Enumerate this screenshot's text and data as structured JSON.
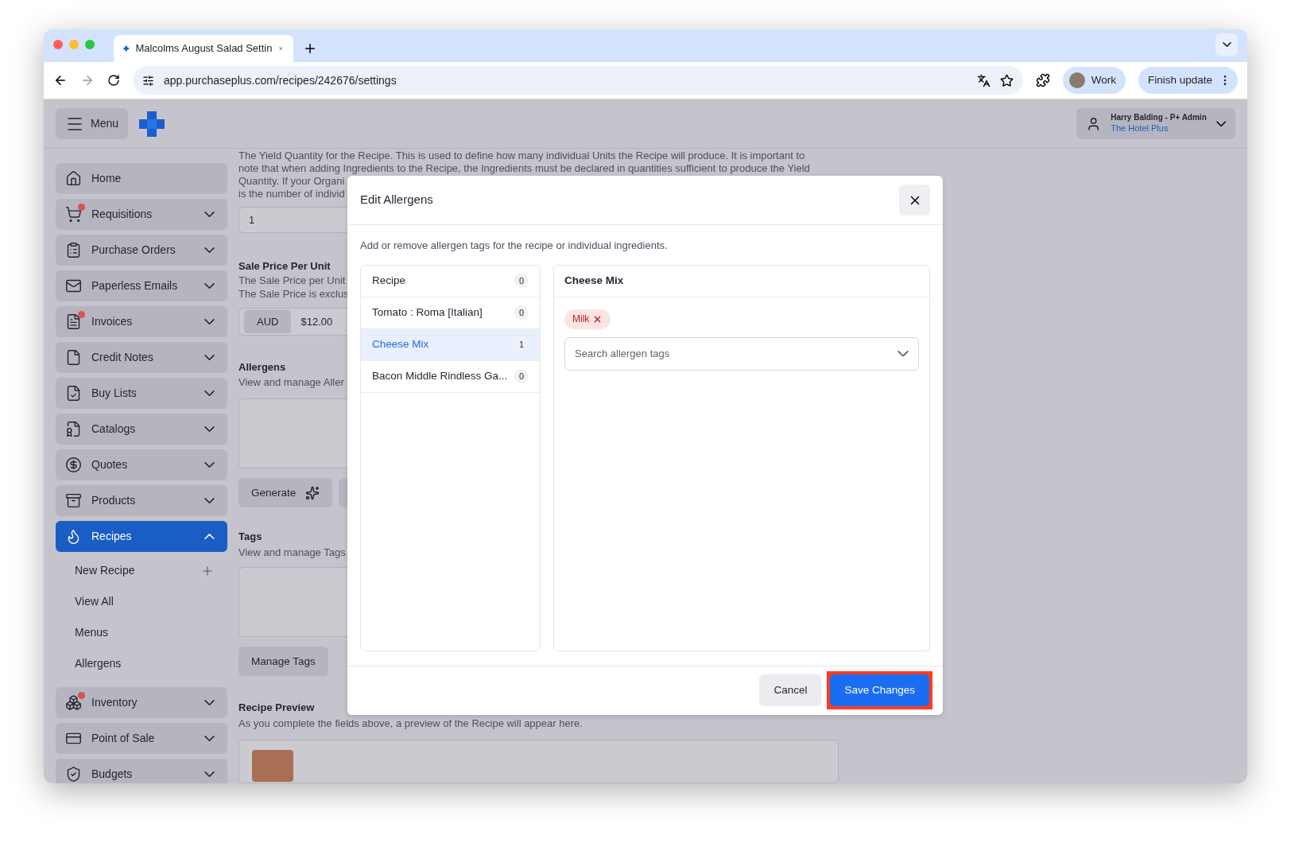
{
  "browser": {
    "tab_title": "Malcolms August Salad Settin",
    "url": "app.purchaseplus.com/recipes/242676/settings",
    "profile": "Work",
    "update_button": "Finish update"
  },
  "header": {
    "menu_label": "Menu",
    "user_name": "Harry Balding - P+ Admin",
    "organisation": "The Hotel Plus"
  },
  "sidebar": {
    "items": [
      {
        "label": "Home",
        "badge": false,
        "selected": false,
        "expandable": false
      },
      {
        "label": "Requisitions",
        "badge": true,
        "selected": false,
        "expandable": true,
        "expanded": false
      },
      {
        "label": "Purchase Orders",
        "badge": false,
        "selected": false,
        "expandable": true,
        "expanded": false
      },
      {
        "label": "Paperless Emails",
        "badge": false,
        "selected": false,
        "expandable": true,
        "expanded": false
      },
      {
        "label": "Invoices",
        "badge": true,
        "selected": false,
        "expandable": true,
        "expanded": false
      },
      {
        "label": "Credit Notes",
        "badge": false,
        "selected": false,
        "expandable": true,
        "expanded": false
      },
      {
        "label": "Buy Lists",
        "badge": false,
        "selected": false,
        "expandable": true,
        "expanded": false
      },
      {
        "label": "Catalogs",
        "badge": false,
        "selected": false,
        "expandable": true,
        "expanded": false
      },
      {
        "label": "Quotes",
        "badge": false,
        "selected": false,
        "expandable": true,
        "expanded": false
      },
      {
        "label": "Products",
        "badge": false,
        "selected": false,
        "expandable": true,
        "expanded": false
      },
      {
        "label": "Recipes",
        "badge": false,
        "selected": true,
        "expandable": true,
        "expanded": true,
        "children": [
          {
            "label": "New Recipe",
            "kind": "add"
          },
          {
            "label": "View All",
            "kind": "link"
          },
          {
            "label": "Menus",
            "kind": "link"
          },
          {
            "label": "Allergens",
            "kind": "link"
          }
        ]
      },
      {
        "label": "Inventory",
        "badge": true,
        "selected": false,
        "expandable": true,
        "expanded": false
      },
      {
        "label": "Point of Sale",
        "badge": false,
        "selected": false,
        "expandable": true,
        "expanded": false
      },
      {
        "label": "Budgets",
        "badge": false,
        "selected": false,
        "expandable": true,
        "expanded": false
      }
    ]
  },
  "content": {
    "yield_lines": [
      "The Yield Quantity for the Recipe. This is used to define how many individual Units the Recipe will produce. It is important to",
      "note that when adding Ingredients to the Recipe, the Ingredients must be declared in quantities sufficient to produce the Yield",
      "Quantity. If your Organi",
      "is the number of individ"
    ],
    "yield_value": "1",
    "sale_price": {
      "heading": "Sale Price Per Unit",
      "lines": [
        "The Sale Price per Unit",
        "The Sale Price is exclus"
      ],
      "currency": "AUD",
      "value": "$12.00"
    },
    "allergens": {
      "heading": "Allergens",
      "description": "View and manage Aller",
      "generate_button": "Generate"
    },
    "tags": {
      "heading": "Tags",
      "description": "View and manage Tags",
      "manage_button": "Manage Tags"
    },
    "preview": {
      "heading": "Recipe Preview",
      "description": "As you complete the fields above, a preview of the Recipe will appear here."
    }
  },
  "modal": {
    "title": "Edit Allergens",
    "description": "Add or remove allergen tags for the recipe or individual ingredients.",
    "items": [
      {
        "label": "Recipe",
        "count": "0",
        "selected": false
      },
      {
        "label": "Tomato : Roma [Italian]",
        "count": "0",
        "selected": false
      },
      {
        "label": "Cheese Mix",
        "count": "1",
        "selected": true
      },
      {
        "label": "Bacon Middle Rindless Ga...",
        "count": "0",
        "selected": false
      }
    ],
    "panel_title": "Cheese Mix",
    "tags": [
      {
        "label": "Milk"
      }
    ],
    "search": {
      "placeholder": "Search allergen tags"
    },
    "cancel_button": "Cancel",
    "save_button": "Save Changes",
    "save_highlighted": true
  }
}
